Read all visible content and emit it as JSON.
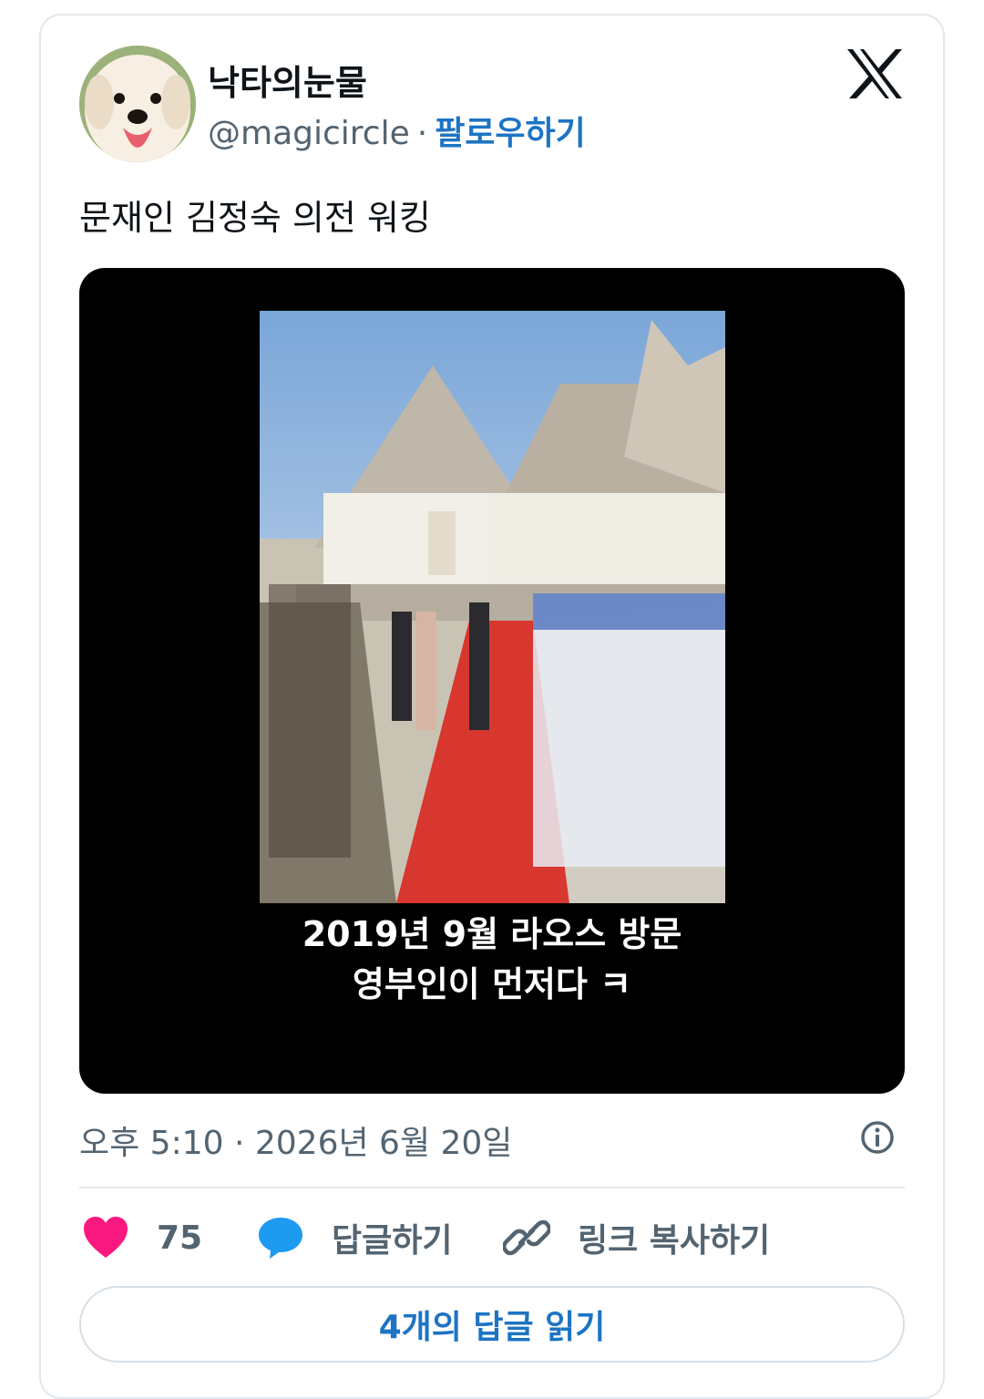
{
  "tweet": {
    "user_name": "낙타의눈물",
    "handle": "@magicircle",
    "separator": "·",
    "follow_label": "팔로우하기",
    "text": "문재인 김정숙 의전 워킹",
    "media": {
      "caption_line1": "2019년 9월 라오스 방문",
      "caption_line2": "영부인이 먼저다 ㅋ"
    },
    "timestamp": "오후 5:10 · 2026년 6월 20일",
    "like_count": "75",
    "reply_label": "답글하기",
    "copy_link_label": "링크 복사하기",
    "read_replies_label": "4개의 답글 읽기"
  },
  "colors": {
    "accent": "#1d74c4",
    "like": "#f91880",
    "reply_icon": "#1d9bf0",
    "muted": "#536471",
    "text": "#0f1419",
    "border": "#e1e8ed"
  },
  "icons": {
    "brand": "x-logo-icon",
    "info": "info-icon",
    "like": "heart-icon",
    "reply": "speech-bubble-icon",
    "link": "link-icon"
  }
}
